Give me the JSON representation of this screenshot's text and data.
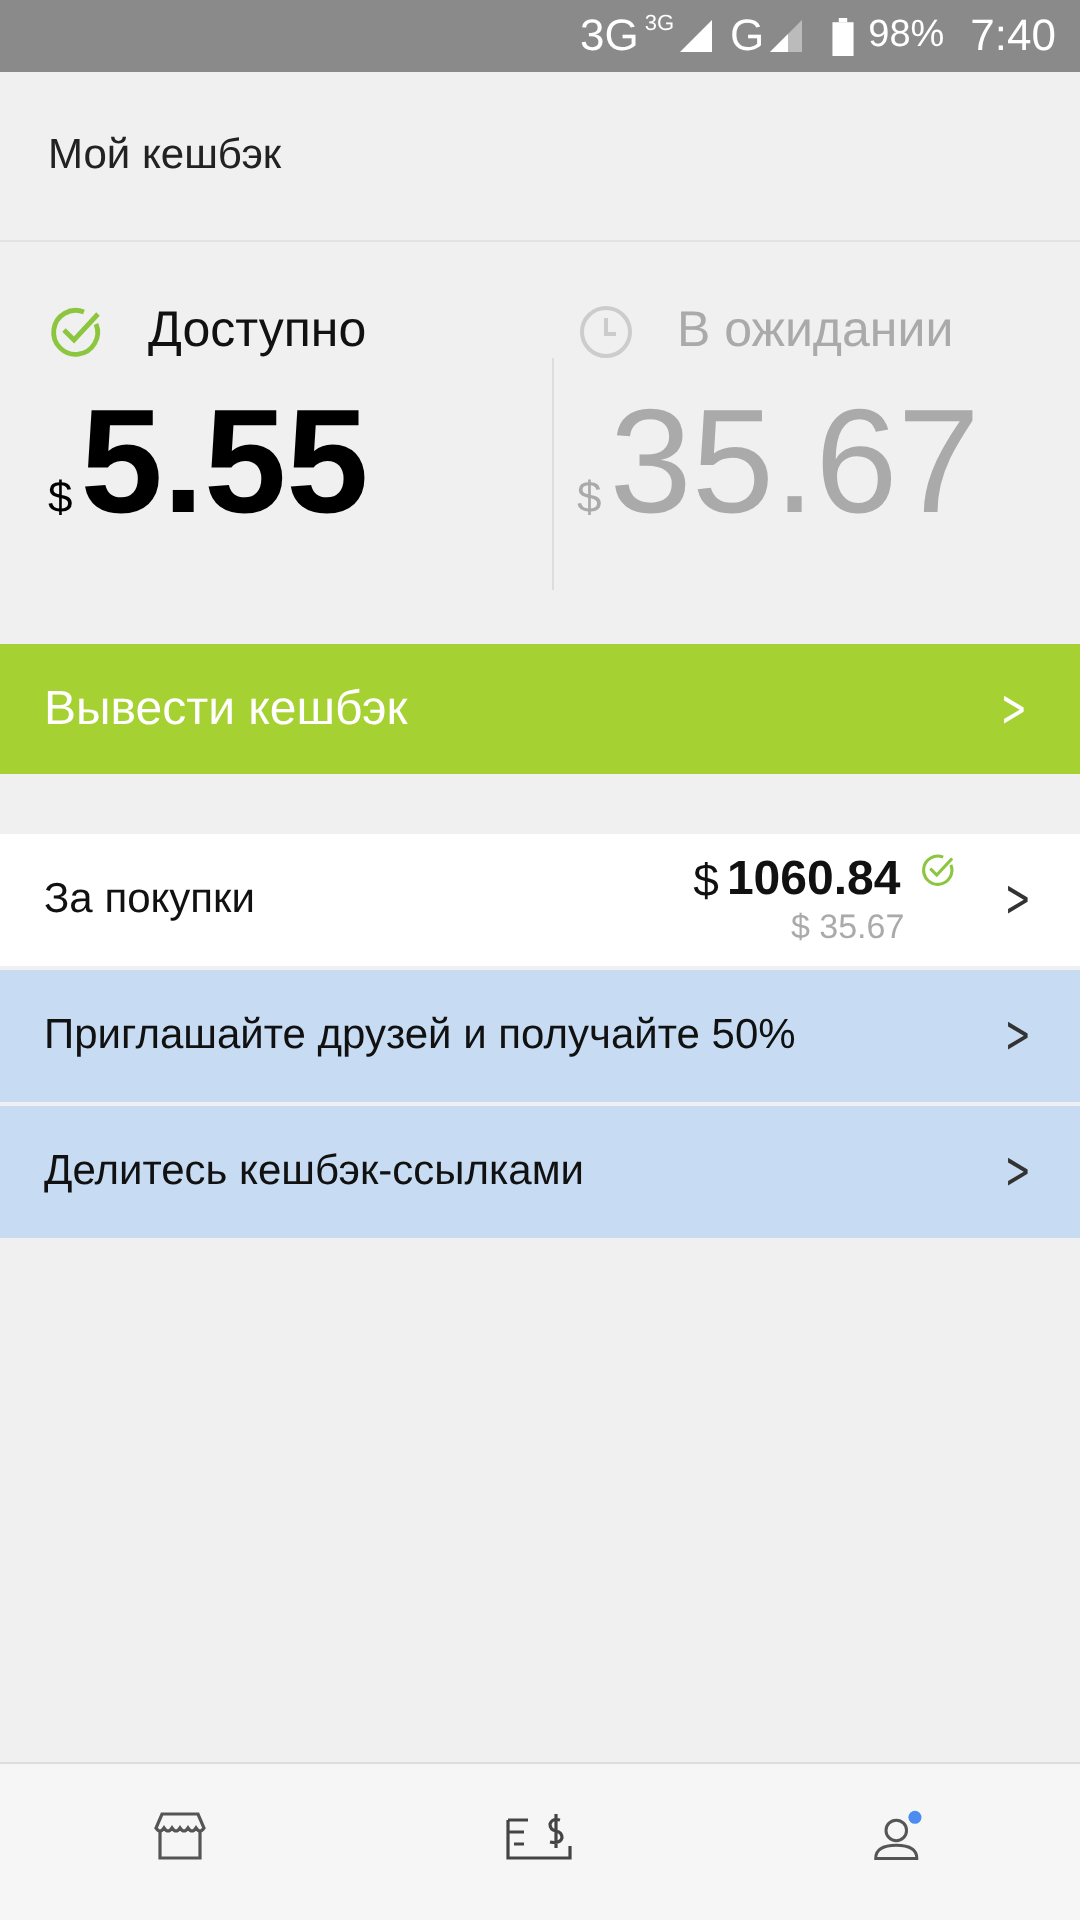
{
  "status_bar": {
    "network_1": "3G",
    "network_1_sup": "3G",
    "network_2": "G",
    "battery": "98%",
    "time": "7:40"
  },
  "header": {
    "title": "Мой кешбэк"
  },
  "balances": [
    {
      "kind": "available",
      "label": "Доступно",
      "currency": "$",
      "amount": "5.55"
    },
    {
      "kind": "pending",
      "label": "В ожидании",
      "currency": "$",
      "amount": "35.67"
    }
  ],
  "withdraw_button": {
    "label": "Вывести кешбэк",
    "chevron": ">"
  },
  "rows": [
    {
      "kind": "purchases",
      "label": "За покупки",
      "amount_currency": "$",
      "amount": "1060.84",
      "pending": "$ 35.67",
      "chevron": ">"
    },
    {
      "kind": "link",
      "label": "Приглашайте друзей и получайте 50%",
      "chevron": ">"
    },
    {
      "kind": "link",
      "label": "Делитесь кешбэк-ссылками",
      "chevron": ">"
    }
  ],
  "bottom_nav": [
    {
      "kind": "shop",
      "notification": false
    },
    {
      "kind": "cheque",
      "notification": false
    },
    {
      "kind": "profile",
      "notification": true
    }
  ]
}
